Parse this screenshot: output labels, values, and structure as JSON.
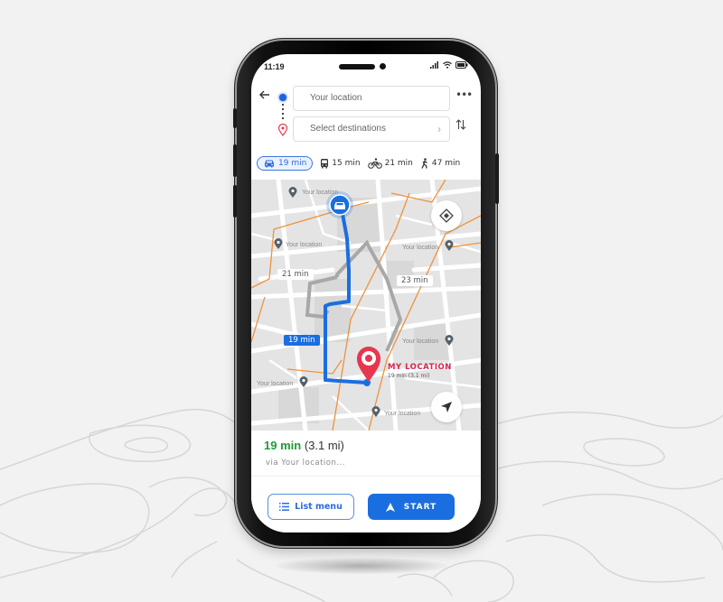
{
  "status_bar": {
    "time": "11:19"
  },
  "directions": {
    "back_icon": "arrow-left-icon",
    "origin_placeholder": "Your location",
    "destination_placeholder": "Select destinations",
    "more_icon": "more-horizontal-icon",
    "swap_icon": "swap-vertical-icon"
  },
  "travel_modes": [
    {
      "icon": "car-icon",
      "label": "19 min",
      "active": true
    },
    {
      "icon": "bus-icon",
      "label": "15 min",
      "active": false
    },
    {
      "icon": "bicycle-icon",
      "label": "21 min",
      "active": false
    },
    {
      "icon": "walk-icon",
      "label": "47 min",
      "active": false
    }
  ],
  "map": {
    "place_labels": [
      "Your location",
      "Your location",
      "Your location",
      "Your location",
      "Your location",
      "Your location"
    ],
    "route_times": {
      "alt_1": "21 min",
      "alt_2": "23 min",
      "primary": "19 min"
    },
    "destination": {
      "title": "MY LOCATION",
      "subtitle": "19 min (3.1 mi)"
    },
    "colors": {
      "route_primary": "#1a6ee0",
      "route_alt": "#a8a8a8",
      "roads_major": "#f0923a",
      "destination_pin": "#e8364f"
    }
  },
  "summary": {
    "duration": "19 min",
    "distance": "(3.1 mi)",
    "via": "via Your location..."
  },
  "actions": {
    "list_menu_label": "List menu",
    "start_label": "START"
  }
}
